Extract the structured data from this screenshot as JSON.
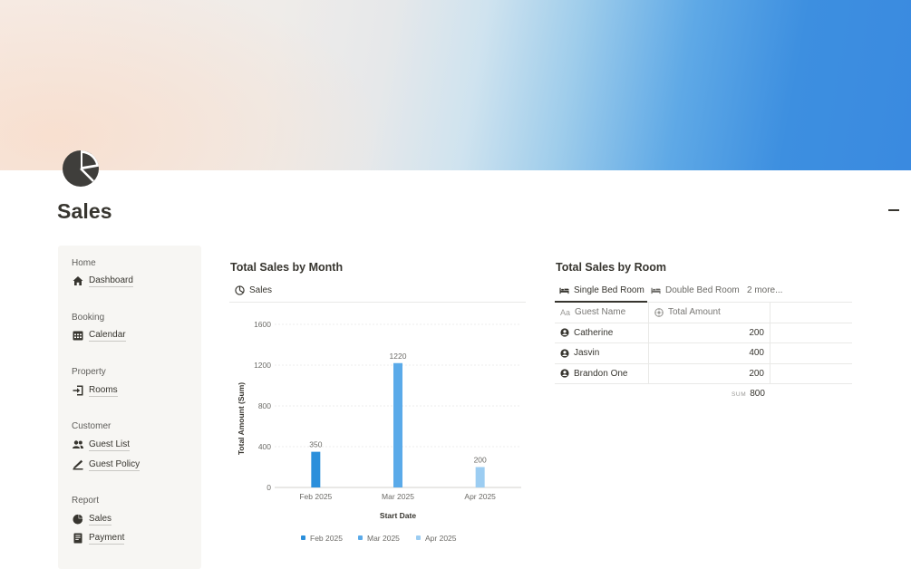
{
  "page": {
    "title": "Sales",
    "icon": "pie-chart-icon"
  },
  "sidebar": {
    "sections": [
      {
        "label": "Home",
        "items": [
          {
            "label": "Dashboard",
            "icon": "home-icon"
          }
        ]
      },
      {
        "label": "Booking",
        "items": [
          {
            "label": "Calendar",
            "icon": "calendar-icon"
          }
        ]
      },
      {
        "label": "Property",
        "items": [
          {
            "label": "Rooms",
            "icon": "door-enter-icon"
          }
        ]
      },
      {
        "label": "Customer",
        "items": [
          {
            "label": "Guest List",
            "icon": "people-icon"
          },
          {
            "label": "Guest Policy",
            "icon": "signature-icon"
          }
        ]
      },
      {
        "label": "Report",
        "items": [
          {
            "label": "Sales",
            "icon": "pie-chart-icon"
          },
          {
            "label": "Payment",
            "icon": "receipt-icon"
          }
        ]
      }
    ]
  },
  "sales_by_month": {
    "title": "Total Sales by Month",
    "view_tab": "Sales",
    "view_icon": "chart-icon"
  },
  "chart_data": {
    "type": "bar",
    "categories": [
      "Feb 2025",
      "Mar 2025",
      "Apr 2025"
    ],
    "values": [
      350,
      1220,
      200
    ],
    "colors": [
      "#2b8fdb",
      "#5aaae9",
      "#9ccdf2"
    ],
    "data_labels": [
      "350",
      "1220",
      "200"
    ],
    "xlabel": "Start Date",
    "ylabel": "Total Amount (Sum)",
    "ylim": [
      0,
      1600
    ],
    "yticks": [
      "0",
      "400",
      "800",
      "1200",
      "1600"
    ],
    "legend": [
      "Feb 2025",
      "Mar 2025",
      "Apr 2025"
    ],
    "legend_position": "bottom",
    "grid": true
  },
  "sales_by_room": {
    "title": "Total Sales by Room",
    "tabs": [
      "Single Bed Room",
      "Double Bed Room",
      "2 more..."
    ],
    "columns": [
      "Guest Name",
      "Total Amount"
    ],
    "rows": [
      {
        "name": "Catherine",
        "amount": "200"
      },
      {
        "name": "Jasvin",
        "amount": "400"
      },
      {
        "name": "Brandon One",
        "amount": "200"
      }
    ],
    "sum_label": "SUM",
    "sum_value": "800"
  },
  "colors": {
    "text": "#37352f",
    "muted": "#787774",
    "sidebar_bg": "#f7f6f3",
    "accent_blue": "#2b8fdb"
  }
}
